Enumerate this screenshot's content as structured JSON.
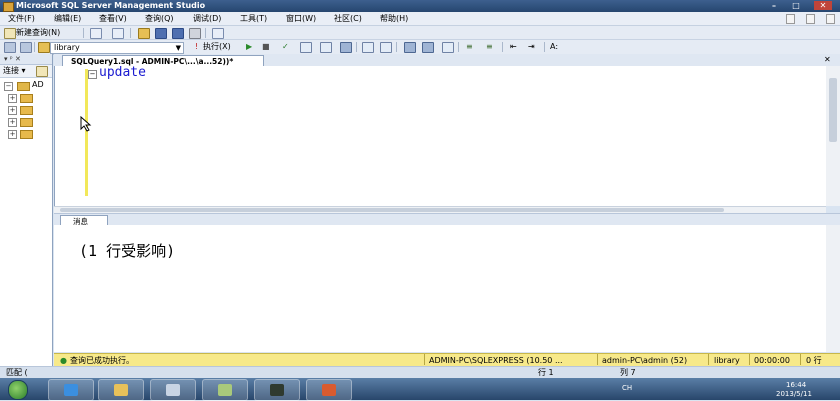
{
  "window": {
    "title": "Microsoft SQL Server Management Studio",
    "controls": {
      "minimize": "–",
      "maximize": "□",
      "close": "✕"
    }
  },
  "menu": [
    "文件(F)",
    "编辑(E)",
    "查看(V)",
    "查询(Q)",
    "调试(D)",
    "工具(T)",
    "窗口(W)",
    "社区(C)",
    "帮助(H)"
  ],
  "toolbar": {
    "new_query_label": "新建查询(N)",
    "database": "library",
    "execute_label": "执行(X)"
  },
  "object_explorer": {
    "connect_label": "连接 ▾",
    "tree_root_label": "AD",
    "pin": "▾ ᵖ ✕"
  },
  "editor": {
    "tab_title": "SQLQuery1.sql - ADMIN-PC\\...\\a...52))*",
    "close": "✕",
    "code": "update"
  },
  "results": {
    "tab_label": "消息",
    "message": "(1 行受影响)"
  },
  "status": {
    "message": "查询已成功执行。",
    "server": "ADMIN-PC\\SQLEXPRESS (10.50 ...",
    "user": "admin-PC\\admin (52)",
    "database": "library",
    "elapsed": "00:00:00",
    "rows": "0 行"
  },
  "ide_status": {
    "left": "匹配 (",
    "line": "行 1",
    "col": "列 7"
  },
  "taskbar": {
    "time": "16:44",
    "date": "2013/5/11",
    "lang": "CH"
  },
  "colors": {
    "status_bg": "#f7e98a",
    "code_keyword": "#1b1bd0",
    "gutter_yellow": "#f2e85a"
  }
}
